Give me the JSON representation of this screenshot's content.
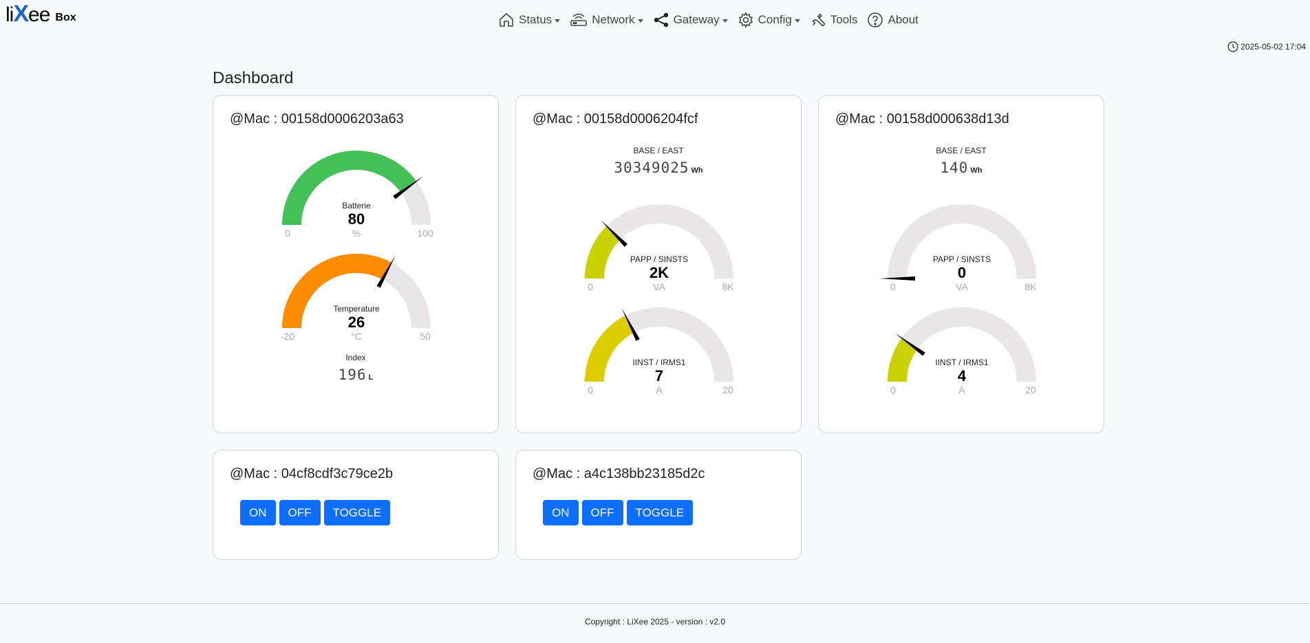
{
  "brand": {
    "name_prefix": "li",
    "name_x": "X",
    "name_suffix": "ee",
    "sub": "Box"
  },
  "nav": {
    "status": "Status",
    "network": "Network",
    "gateway": "Gateway",
    "config": "Config",
    "tools": "Tools",
    "about": "About"
  },
  "clock": "2025-05-02 17:04",
  "page_title": "Dashboard",
  "cards": [
    {
      "title": "@Mac : 00158d0006203a63",
      "gauges": [
        {
          "label": "Batterie",
          "value": "80",
          "unit": "%",
          "min": "0",
          "max": "100",
          "fraction": 0.8,
          "color": "#43c058"
        },
        {
          "label": "Temperature",
          "value": "26",
          "unit": "°C",
          "min": "-20",
          "max": "50",
          "fraction": 0.657,
          "color": "#fb8c00"
        }
      ],
      "meter": {
        "label": "Index",
        "value": "196",
        "unit": "L"
      }
    },
    {
      "title": "@Mac : 00158d0006204fcf",
      "meter": {
        "label": "BASE / EAST",
        "value": "30349025",
        "unit": "Wh"
      },
      "gauges": [
        {
          "label": "PAPP / SINSTS",
          "value": "2K",
          "unit": "VA",
          "min": "0",
          "max": "8K",
          "fraction": 0.25,
          "color": "#c9d200"
        },
        {
          "label": "IINST / IRMS1",
          "value": "7",
          "unit": "A",
          "min": "0",
          "max": "20",
          "fraction": 0.35,
          "color": "#ddcc00"
        }
      ]
    },
    {
      "title": "@Mac : 00158d000638d13d",
      "meter": {
        "label": "BASE / EAST",
        "value": "140",
        "unit": "Wh"
      },
      "gauges": [
        {
          "label": "PAPP / SINSTS",
          "value": "0",
          "unit": "VA",
          "min": "0",
          "max": "8K",
          "fraction": 0.0,
          "color": "#c9d200"
        },
        {
          "label": "IINST / IRMS1",
          "value": "4",
          "unit": "A",
          "min": "0",
          "max": "20",
          "fraction": 0.2,
          "color": "#c9d200"
        }
      ]
    },
    {
      "title": "@Mac : 04cf8cdf3c79ce2b",
      "buttons": {
        "on": "ON",
        "off": "OFF",
        "toggle": "TOGGLE"
      }
    },
    {
      "title": "@Mac : a4c138bb23185d2c",
      "buttons": {
        "on": "ON",
        "off": "OFF",
        "toggle": "TOGGLE"
      }
    }
  ],
  "footer": "Copyright : LiXee 2025 - version : v2.0",
  "colors": {
    "accent": "#0d6efd",
    "gauge_track": "#e8e6e6",
    "brand_blue": "#1565d8"
  }
}
